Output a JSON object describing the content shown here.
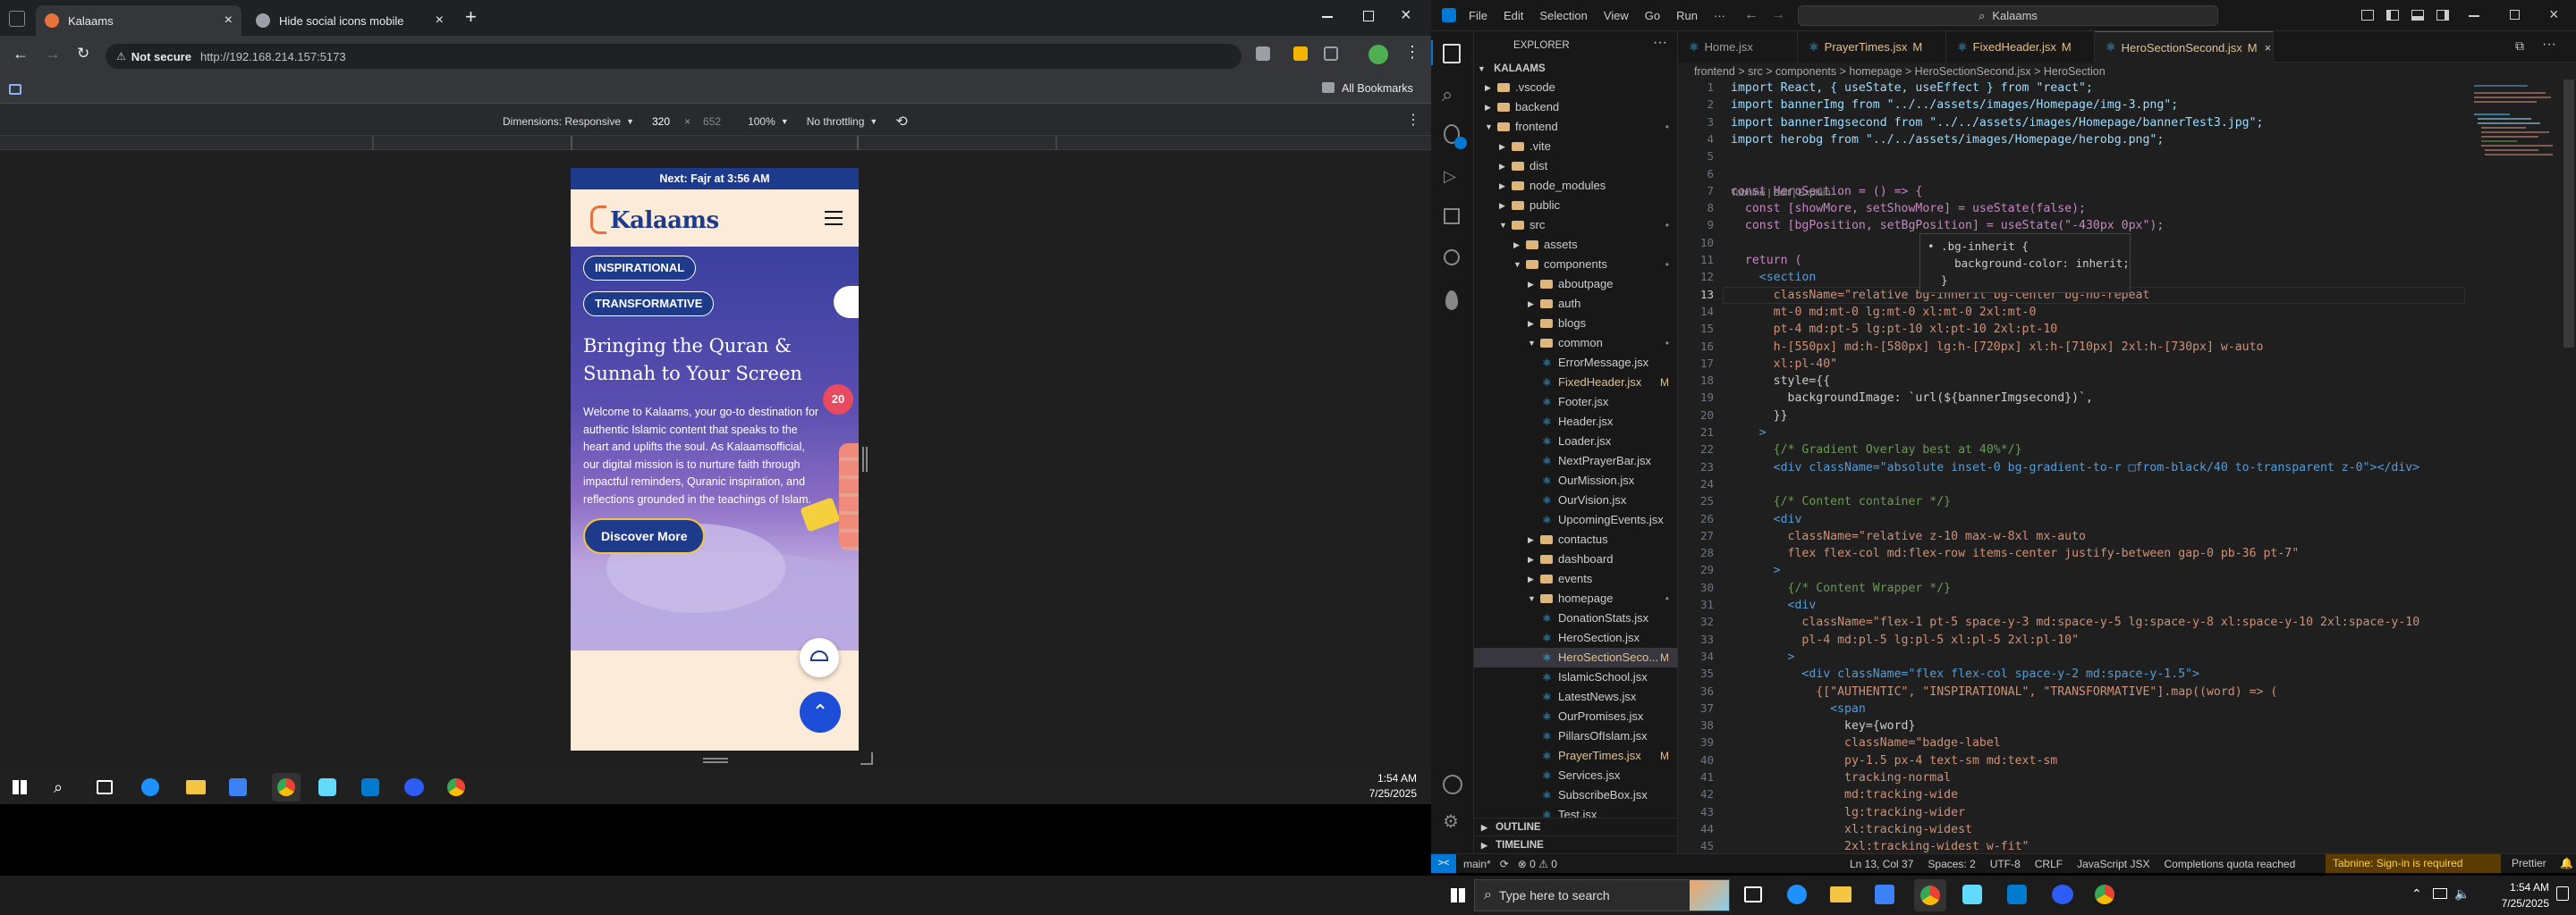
{
  "chrome": {
    "tabs": [
      {
        "title": "Kalaams",
        "active": true
      },
      {
        "title": "Hide social icons mobile",
        "active": false
      }
    ],
    "new_tab_symbol": "+",
    "close_symbol": "×",
    "security_label": "Not secure",
    "url": "http://192.168.214.157:5173",
    "all_bookmarks": "All Bookmarks",
    "devtools": {
      "dimensions_label": "Dimensions: Responsive",
      "width": "320",
      "times": "×",
      "height": "652",
      "zoom": "100%",
      "throttle": "No throttling"
    }
  },
  "site": {
    "banner": "Next: Fajr at 3:56 AM",
    "brand": "Kalaams",
    "menu_icon": "hamburger-icon",
    "badges": [
      "INSPIRATIONAL",
      "TRANSFORMATIVE"
    ],
    "heading_line1": "Bringing the Quran &",
    "heading_line2": "Sunnah to Your Screen",
    "paragraph_lines": [
      "Welcome to Kalaams, your go-to destination for",
      "authentic Islamic content that speaks to the",
      "heart and uplifts the soul. As Kalaamsofficial,",
      "our digital mission is to nurture faith through",
      "impactful reminders, Quranic inspiration, and",
      "reflections grounded in the teachings of Islam."
    ],
    "cta": "Discover More",
    "badge_20": "20"
  },
  "taskbar_top": {
    "time": "1:54 AM",
    "date": "7/25/2025"
  },
  "vscode": {
    "menu": [
      "File",
      "Edit",
      "Selection",
      "View",
      "Go",
      "Run",
      "···"
    ],
    "search_box": "Kalaams",
    "tabs": [
      {
        "name": "Home.jsx",
        "mod": ""
      },
      {
        "name": "PrayerTimes.jsx",
        "mod": "M"
      },
      {
        "name": "FixedHeader.jsx",
        "mod": "M"
      },
      {
        "name": "HeroSectionSecond.jsx",
        "mod": "M",
        "active": true
      }
    ],
    "breadcrumb": "frontend > src > components > homepage > HeroSectionSecond.jsx > HeroSection",
    "explorer_title": "EXPLORER",
    "project": "KALAAMS",
    "tree": [
      {
        "label": ".vscode",
        "depth": 1,
        "type": "folder-closed"
      },
      {
        "label": "backend",
        "depth": 1,
        "type": "folder-closed"
      },
      {
        "label": "frontend",
        "depth": 1,
        "type": "folder-open",
        "mark": "•"
      },
      {
        "label": ".vite",
        "depth": 2,
        "type": "folder-closed"
      },
      {
        "label": "dist",
        "depth": 2,
        "type": "folder-closed"
      },
      {
        "label": "node_modules",
        "depth": 2,
        "type": "folder-closed"
      },
      {
        "label": "public",
        "depth": 2,
        "type": "folder-closed"
      },
      {
        "label": "src",
        "depth": 2,
        "type": "folder-open",
        "mark": "•"
      },
      {
        "label": "assets",
        "depth": 3,
        "type": "folder-closed"
      },
      {
        "label": "components",
        "depth": 3,
        "type": "folder-open",
        "mark": "•"
      },
      {
        "label": "aboutpage",
        "depth": 4,
        "type": "folder-closed"
      },
      {
        "label": "auth",
        "depth": 4,
        "type": "folder-closed"
      },
      {
        "label": "blogs",
        "depth": 4,
        "type": "folder-closed"
      },
      {
        "label": "common",
        "depth": 4,
        "type": "folder-open",
        "mark": "•"
      },
      {
        "label": "ErrorMessage.jsx",
        "depth": 5,
        "type": "file"
      },
      {
        "label": "FixedHeader.jsx",
        "depth": 5,
        "type": "file",
        "mark": "M"
      },
      {
        "label": "Footer.jsx",
        "depth": 5,
        "type": "file"
      },
      {
        "label": "Header.jsx",
        "depth": 5,
        "type": "file"
      },
      {
        "label": "Loader.jsx",
        "depth": 5,
        "type": "file"
      },
      {
        "label": "NextPrayerBar.jsx",
        "depth": 5,
        "type": "file"
      },
      {
        "label": "OurMission.jsx",
        "depth": 5,
        "type": "file"
      },
      {
        "label": "OurVision.jsx",
        "depth": 5,
        "type": "file"
      },
      {
        "label": "UpcomingEvents.jsx",
        "depth": 5,
        "type": "file"
      },
      {
        "label": "contactus",
        "depth": 4,
        "type": "folder-closed"
      },
      {
        "label": "dashboard",
        "depth": 4,
        "type": "folder-closed"
      },
      {
        "label": "events",
        "depth": 4,
        "type": "folder-closed"
      },
      {
        "label": "homepage",
        "depth": 4,
        "type": "folder-open",
        "mark": "•"
      },
      {
        "label": "DonationStats.jsx",
        "depth": 5,
        "type": "file"
      },
      {
        "label": "HeroSection.jsx",
        "depth": 5,
        "type": "file"
      },
      {
        "label": "HeroSectionSeco...",
        "depth": 5,
        "type": "file",
        "mark": "M",
        "selected": true
      },
      {
        "label": "IslamicSchool.jsx",
        "depth": 5,
        "type": "file"
      },
      {
        "label": "LatestNews.jsx",
        "depth": 5,
        "type": "file"
      },
      {
        "label": "OurPromises.jsx",
        "depth": 5,
        "type": "file"
      },
      {
        "label": "PillarsOfIslam.jsx",
        "depth": 5,
        "type": "file"
      },
      {
        "label": "PrayerTimes.jsx",
        "depth": 5,
        "type": "file",
        "mark": "M"
      },
      {
        "label": "Services.jsx",
        "depth": 5,
        "type": "file"
      },
      {
        "label": "SubscribeBox.jsx",
        "depth": 5,
        "type": "file"
      },
      {
        "label": "Test.jsx",
        "depth": 5,
        "type": "file"
      }
    ],
    "outline": "OUTLINE",
    "timeline": "TIMELINE",
    "codelens": "Tabnine | Edit | Explain",
    "hover": [
      "• .bg-inherit {",
      "    background-color: inherit;",
      "  }"
    ],
    "code": [
      {
        "n": "1",
        "t": "import React, { useState, useEffect } from \"react\";"
      },
      {
        "n": "2",
        "t": "import bannerImg from \"../../assets/images/Homepage/img-3.png\";"
      },
      {
        "n": "3",
        "t": "import bannerImgsecond from \"../../assets/images/Homepage/bannerTest3.jpg\";"
      },
      {
        "n": "4",
        "t": "import herobg from \"../../assets/images/Homepage/herobg.png\";"
      },
      {
        "n": "5",
        "t": ""
      },
      {
        "n": "6",
        "t": ""
      },
      {
        "n": "7",
        "t": "const HeroSection = () => {"
      },
      {
        "n": "8",
        "t": "  const [showMore, setShowMore] = useState(false);"
      },
      {
        "n": "9",
        "t": "  const [bgPosition, setBgPosition] = useState(\"-430px 0px\");"
      },
      {
        "n": "10",
        "t": ""
      },
      {
        "n": "11",
        "t": "  return ("
      },
      {
        "n": "12",
        "t": "    <section"
      },
      {
        "n": "13",
        "t": "      className=\"relative bg-inherit bg-center bg-no-repeat"
      },
      {
        "n": "14",
        "t": "      mt-0 md:mt-0 lg:mt-0 xl:mt-0 2xl:mt-0"
      },
      {
        "n": "15",
        "t": "      pt-4 md:pt-5 lg:pt-10 xl:pt-10 2xl:pt-10"
      },
      {
        "n": "16",
        "t": "      h-[550px] md:h-[580px] lg:h-[720px] xl:h-[710px] 2xl:h-[730px] w-auto"
      },
      {
        "n": "17",
        "t": "      xl:pl-40\""
      },
      {
        "n": "18",
        "t": "      style={{"
      },
      {
        "n": "19",
        "t": "        backgroundImage: `url(${bannerImgsecond})`,"
      },
      {
        "n": "20",
        "t": "      }}"
      },
      {
        "n": "21",
        "t": "    >"
      },
      {
        "n": "22",
        "t": "      {/* Gradient Overlay best at 40%*/}"
      },
      {
        "n": "23",
        "t": "      <div className=\"absolute inset-0 bg-gradient-to-r □from-black/40 to-transparent z-0\"></div>"
      },
      {
        "n": "24",
        "t": ""
      },
      {
        "n": "25",
        "t": "      {/* Content container */}"
      },
      {
        "n": "26",
        "t": "      <div"
      },
      {
        "n": "27",
        "t": "        className=\"relative z-10 max-w-8xl mx-auto"
      },
      {
        "n": "28",
        "t": "        flex flex-col md:flex-row items-center justify-between gap-0 pb-36 pt-7\""
      },
      {
        "n": "29",
        "t": "      >"
      },
      {
        "n": "30",
        "t": "        {/* Content Wrapper */}"
      },
      {
        "n": "31",
        "t": "        <div"
      },
      {
        "n": "32",
        "t": "          className=\"flex-1 pt-5 space-y-3 md:space-y-5 lg:space-y-8 xl:space-y-10 2xl:space-y-10"
      },
      {
        "n": "33",
        "t": "          pl-4 md:pl-5 lg:pl-5 xl:pl-5 2xl:pl-10\""
      },
      {
        "n": "34",
        "t": "        >"
      },
      {
        "n": "35",
        "t": "          <div className=\"flex flex-col space-y-2 md:space-y-1.5\">"
      },
      {
        "n": "36",
        "t": "            {[\"AUTHENTIC\", \"INSPIRATIONAL\", \"TRANSFORMATIVE\"].map((word) => ("
      },
      {
        "n": "37",
        "t": "              <span"
      },
      {
        "n": "38",
        "t": "                key={word}"
      },
      {
        "n": "39",
        "t": "                className=\"badge-label"
      },
      {
        "n": "40",
        "t": "                py-1.5 px-4 text-sm md:text-sm"
      },
      {
        "n": "41",
        "t": "                tracking-normal"
      },
      {
        "n": "42",
        "t": "                md:tracking-wide"
      },
      {
        "n": "43",
        "t": "                lg:tracking-wider"
      },
      {
        "n": "44",
        "t": "                xl:tracking-widest"
      },
      {
        "n": "45",
        "t": "                2xl:tracking-widest w-fit\""
      }
    ],
    "status": {
      "branch": "main*",
      "sync": "⟳",
      "problems": "⊗ 0 ⚠ 0",
      "position": "Ln 13, Col 37",
      "spaces": "Spaces: 2",
      "encoding": "UTF-8",
      "eol": "CRLF",
      "language": "JavaScript JSX",
      "quota": "Completions quota reached",
      "tabnine": "Tabnine: Sign-in is required",
      "prettier": "Prettier"
    }
  },
  "taskbar": {
    "search_placeholder": "Type here to search",
    "time": "1:54 AM",
    "date": "7/25/2025"
  },
  "colors": {
    "vscode_accent": "#0078d4",
    "site_blue": "#1e3a8a",
    "site_orange": "#e8723b",
    "modified": "#e2c08d",
    "tabnine_yellow": "#ffd23f"
  }
}
